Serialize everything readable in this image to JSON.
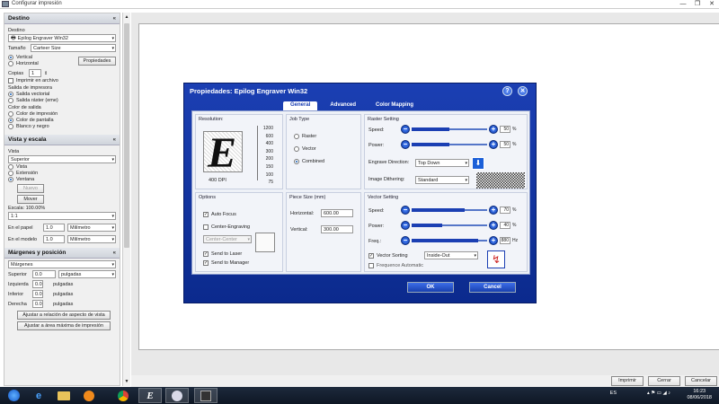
{
  "window": {
    "title": "Configurar impresión",
    "min": "—",
    "max": "❐",
    "close": "✕"
  },
  "left": {
    "destino": {
      "header": "Destino",
      "label": "Destino",
      "printer": "Epilog Engraver Win32",
      "size_label": "Tamaño",
      "size_value": "Carteer Size",
      "orient_v": "Vertical",
      "orient_h": "Horizontal",
      "properties_btn": "Propiedades",
      "copies_label": "Copias",
      "copies_value": "1",
      "print_to_file": "Imprimir en archivo",
      "output_label": "Salida de impresora",
      "output_vector": "Salida vectorial",
      "output_raster": "Salida ráster (eme)",
      "color_label": "Color de salida",
      "color_1": "Color de impresión",
      "color_2": "Color de pantalla",
      "color_3": "Blanco y negro"
    },
    "vista": {
      "header": "Vista y escala",
      "label": "Vista",
      "view_value": "Superior",
      "opt_vista": "Vista",
      "opt_extension": "Extensión",
      "opt_ventana": "Ventana",
      "btn_nuevo": "Nuevo",
      "btn_mover": "Mover",
      "scale_label": "Escala: 100.00%",
      "scale_value": "1:1",
      "paper_label": "En el papel",
      "paper_value": "1.0",
      "paper_unit": "Milímetro",
      "model_label": "En el modelo",
      "model_value": "1.0",
      "model_unit": "Milímetro"
    },
    "margenes": {
      "header": "Márgenes y posición",
      "combo": "Márgenes",
      "sup_label": "Superior",
      "sup_value": "0.0",
      "sup_unit": "pulgadas",
      "izq_label": "Izquierda",
      "izq_value": "0.0",
      "izq_unit": "pulgadas",
      "inf_label": "Inferior",
      "inf_value": "0.0",
      "inf_unit": "pulgadas",
      "der_label": "Derecha",
      "der_value": "0.0",
      "der_unit": "pulgadas",
      "btn_ajustar": "Ajustar a relación de aspecto de vista",
      "btn_area": "Ajustar a área máxima de impresión"
    }
  },
  "bottom": {
    "print": "Imprimir",
    "close": "Cerrar",
    "cancel": "Cancelar"
  },
  "dialog": {
    "title": "Propiedades: Epilog Engraver Win32",
    "help": "?",
    "close": "✕",
    "tabs": [
      "General",
      "Advanced",
      "Color Mapping"
    ],
    "resolution": {
      "label": "Resolution:",
      "values": [
        "1200",
        "600",
        "400",
        "300",
        "200",
        "150",
        "100",
        "75"
      ],
      "current": "400 DPI"
    },
    "job_type": {
      "label": "Job Type",
      "raster": "Raster",
      "vector": "Vector",
      "combined": "Combined"
    },
    "options": {
      "label": "Options",
      "auto_focus": "Auto Focus",
      "center_engraving": "Center-Engraving",
      "center_combo": "Center-Center",
      "send_laser": "Send to Laser",
      "send_manager": "Send to Manager"
    },
    "piece_size": {
      "label": "Piece Size (mm)",
      "h_label": "Horizontal:",
      "h_value": "600.00",
      "v_label": "Vertical:",
      "v_value": "300.00"
    },
    "raster_setting": {
      "label": "Raster Setting",
      "speed_label": "Speed:",
      "speed_value": "50",
      "speed_unit": "%",
      "speed_pct": 50,
      "power_label": "Power:",
      "power_value": "50",
      "power_unit": "%",
      "power_pct": 50,
      "direction_label": "Engrave Direction:",
      "direction_value": "Top Down",
      "dither_label": "Image Dithering:",
      "dither_value": "Standard"
    },
    "vector_setting": {
      "label": "Vector Setting",
      "speed_label": "Speed:",
      "speed_value": "70",
      "speed_unit": "%",
      "speed_pct": 70,
      "power_label": "Power:",
      "power_value": "40",
      "power_unit": "%",
      "power_pct": 40,
      "freq_label": "Freq.:",
      "freq_value": "880",
      "freq_unit": "Hz",
      "freq_pct": 88,
      "sorting_label": "Vector Sorting",
      "sorting_value": "Inside-Out",
      "freq_auto": "Frequence Automatic"
    },
    "ok": "OK",
    "cancel": "Cancel"
  },
  "taskbar": {
    "lang": "ES",
    "time": "16:23",
    "date": "08/06/2018"
  },
  "colors": {
    "dialog_blue": "#1b3fb3",
    "taskbar": "#0e1724"
  }
}
